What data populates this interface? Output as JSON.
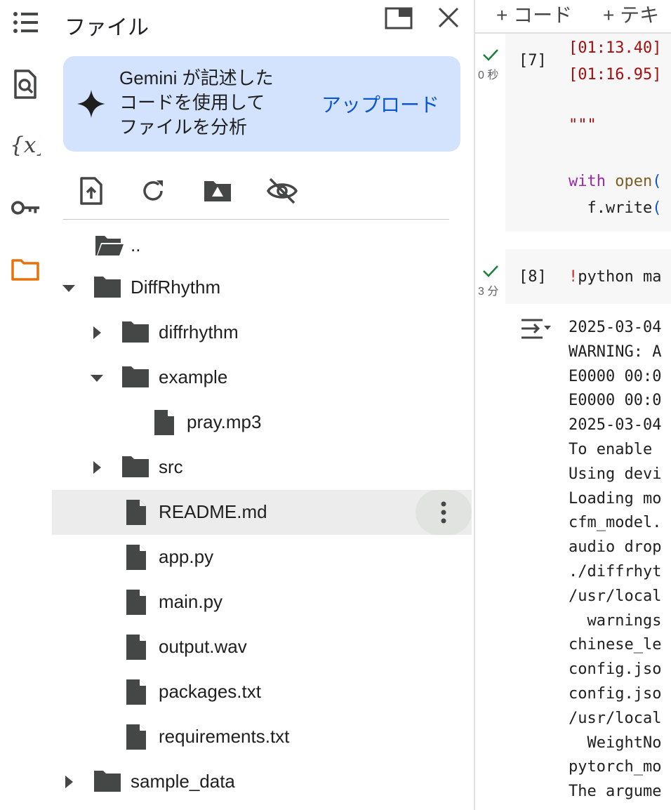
{
  "sidebar_rail": {
    "icons": [
      "toc-icon",
      "find-icon",
      "variables-icon",
      "secrets-key-icon",
      "files-folder-icon"
    ],
    "active": "files-folder-icon",
    "active_color": "#e8710a"
  },
  "panel": {
    "title": "ファイル",
    "gemini": {
      "text": "Gemini が記述した\nコードを使用して\nファイルを分析",
      "upload_label": "アップロード"
    },
    "tree": [
      {
        "label": "..",
        "type": "parent-folder",
        "depth": 0
      },
      {
        "label": "DiffRhythm",
        "type": "folder",
        "expanded": true,
        "depth": 0
      },
      {
        "label": "diffrhythm",
        "type": "folder",
        "expanded": false,
        "depth": 1
      },
      {
        "label": "example",
        "type": "folder",
        "expanded": true,
        "depth": 1
      },
      {
        "label": "pray.mp3",
        "type": "file",
        "depth": 2
      },
      {
        "label": "src",
        "type": "folder",
        "expanded": false,
        "depth": 1
      },
      {
        "label": "README.md",
        "type": "file",
        "depth": 1,
        "selected": true
      },
      {
        "label": "app.py",
        "type": "file",
        "depth": 1
      },
      {
        "label": "main.py",
        "type": "file",
        "depth": 1
      },
      {
        "label": "output.wav",
        "type": "file",
        "depth": 1
      },
      {
        "label": "packages.txt",
        "type": "file",
        "depth": 1
      },
      {
        "label": "requirements.txt",
        "type": "file",
        "depth": 1
      },
      {
        "label": "sample_data",
        "type": "folder",
        "expanded": false,
        "depth": 0
      }
    ]
  },
  "notebook": {
    "toolbar": {
      "add_code": "+ コード",
      "add_text": "+ テキ"
    },
    "cell7": {
      "exec": "[7]",
      "time": "0 秒",
      "lines": [
        "[01:13.40]",
        "[01:16.95]",
        "",
        "\"\"\"",
        "",
        "",
        "with open(",
        "  f.write("
      ]
    },
    "cell8": {
      "exec": "[8]",
      "time": "3 分",
      "code": "!python ma",
      "output": [
        "2025-03-04",
        "WARNING: A",
        "E0000 00:0",
        "E0000 00:0",
        "2025-03-04",
        "To enable ",
        "Using devi",
        "Loading mo",
        "cfm_model.",
        "audio drop",
        "./diffrhyt",
        "/usr/local",
        "  warnings",
        "chinese_le",
        "config.jso",
        "config.jso",
        "/usr/local",
        "  WeightNo",
        "pytorch_mo",
        "The argume"
      ]
    },
    "colors": {
      "check": "#188038",
      "time_code": "#a50e0e",
      "keyword": "#9c27b0",
      "builtin": "#795e26"
    }
  }
}
